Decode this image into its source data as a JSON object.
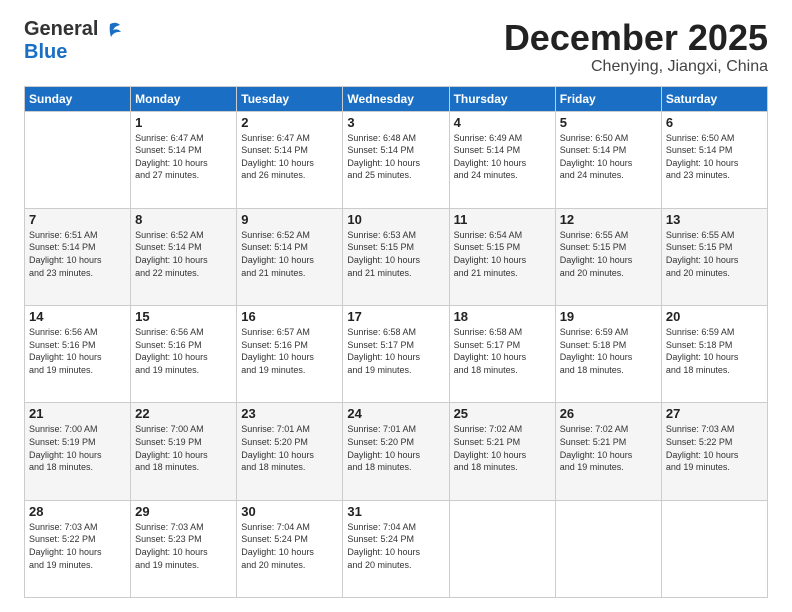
{
  "logo": {
    "line1": "General",
    "line2": "Blue"
  },
  "header": {
    "month": "December 2025",
    "location": "Chenying, Jiangxi, China"
  },
  "weekdays": [
    "Sunday",
    "Monday",
    "Tuesday",
    "Wednesday",
    "Thursday",
    "Friday",
    "Saturday"
  ],
  "weeks": [
    [
      {
        "day": "",
        "info": ""
      },
      {
        "day": "1",
        "info": "Sunrise: 6:47 AM\nSunset: 5:14 PM\nDaylight: 10 hours\nand 27 minutes."
      },
      {
        "day": "2",
        "info": "Sunrise: 6:47 AM\nSunset: 5:14 PM\nDaylight: 10 hours\nand 26 minutes."
      },
      {
        "day": "3",
        "info": "Sunrise: 6:48 AM\nSunset: 5:14 PM\nDaylight: 10 hours\nand 25 minutes."
      },
      {
        "day": "4",
        "info": "Sunrise: 6:49 AM\nSunset: 5:14 PM\nDaylight: 10 hours\nand 24 minutes."
      },
      {
        "day": "5",
        "info": "Sunrise: 6:50 AM\nSunset: 5:14 PM\nDaylight: 10 hours\nand 24 minutes."
      },
      {
        "day": "6",
        "info": "Sunrise: 6:50 AM\nSunset: 5:14 PM\nDaylight: 10 hours\nand 23 minutes."
      }
    ],
    [
      {
        "day": "7",
        "info": "Sunrise: 6:51 AM\nSunset: 5:14 PM\nDaylight: 10 hours\nand 23 minutes."
      },
      {
        "day": "8",
        "info": "Sunrise: 6:52 AM\nSunset: 5:14 PM\nDaylight: 10 hours\nand 22 minutes."
      },
      {
        "day": "9",
        "info": "Sunrise: 6:52 AM\nSunset: 5:14 PM\nDaylight: 10 hours\nand 21 minutes."
      },
      {
        "day": "10",
        "info": "Sunrise: 6:53 AM\nSunset: 5:15 PM\nDaylight: 10 hours\nand 21 minutes."
      },
      {
        "day": "11",
        "info": "Sunrise: 6:54 AM\nSunset: 5:15 PM\nDaylight: 10 hours\nand 21 minutes."
      },
      {
        "day": "12",
        "info": "Sunrise: 6:55 AM\nSunset: 5:15 PM\nDaylight: 10 hours\nand 20 minutes."
      },
      {
        "day": "13",
        "info": "Sunrise: 6:55 AM\nSunset: 5:15 PM\nDaylight: 10 hours\nand 20 minutes."
      }
    ],
    [
      {
        "day": "14",
        "info": "Sunrise: 6:56 AM\nSunset: 5:16 PM\nDaylight: 10 hours\nand 19 minutes."
      },
      {
        "day": "15",
        "info": "Sunrise: 6:56 AM\nSunset: 5:16 PM\nDaylight: 10 hours\nand 19 minutes."
      },
      {
        "day": "16",
        "info": "Sunrise: 6:57 AM\nSunset: 5:16 PM\nDaylight: 10 hours\nand 19 minutes."
      },
      {
        "day": "17",
        "info": "Sunrise: 6:58 AM\nSunset: 5:17 PM\nDaylight: 10 hours\nand 19 minutes."
      },
      {
        "day": "18",
        "info": "Sunrise: 6:58 AM\nSunset: 5:17 PM\nDaylight: 10 hours\nand 18 minutes."
      },
      {
        "day": "19",
        "info": "Sunrise: 6:59 AM\nSunset: 5:18 PM\nDaylight: 10 hours\nand 18 minutes."
      },
      {
        "day": "20",
        "info": "Sunrise: 6:59 AM\nSunset: 5:18 PM\nDaylight: 10 hours\nand 18 minutes."
      }
    ],
    [
      {
        "day": "21",
        "info": "Sunrise: 7:00 AM\nSunset: 5:19 PM\nDaylight: 10 hours\nand 18 minutes."
      },
      {
        "day": "22",
        "info": "Sunrise: 7:00 AM\nSunset: 5:19 PM\nDaylight: 10 hours\nand 18 minutes."
      },
      {
        "day": "23",
        "info": "Sunrise: 7:01 AM\nSunset: 5:20 PM\nDaylight: 10 hours\nand 18 minutes."
      },
      {
        "day": "24",
        "info": "Sunrise: 7:01 AM\nSunset: 5:20 PM\nDaylight: 10 hours\nand 18 minutes."
      },
      {
        "day": "25",
        "info": "Sunrise: 7:02 AM\nSunset: 5:21 PM\nDaylight: 10 hours\nand 18 minutes."
      },
      {
        "day": "26",
        "info": "Sunrise: 7:02 AM\nSunset: 5:21 PM\nDaylight: 10 hours\nand 19 minutes."
      },
      {
        "day": "27",
        "info": "Sunrise: 7:03 AM\nSunset: 5:22 PM\nDaylight: 10 hours\nand 19 minutes."
      }
    ],
    [
      {
        "day": "28",
        "info": "Sunrise: 7:03 AM\nSunset: 5:22 PM\nDaylight: 10 hours\nand 19 minutes."
      },
      {
        "day": "29",
        "info": "Sunrise: 7:03 AM\nSunset: 5:23 PM\nDaylight: 10 hours\nand 19 minutes."
      },
      {
        "day": "30",
        "info": "Sunrise: 7:04 AM\nSunset: 5:24 PM\nDaylight: 10 hours\nand 20 minutes."
      },
      {
        "day": "31",
        "info": "Sunrise: 7:04 AM\nSunset: 5:24 PM\nDaylight: 10 hours\nand 20 minutes."
      },
      {
        "day": "",
        "info": ""
      },
      {
        "day": "",
        "info": ""
      },
      {
        "day": "",
        "info": ""
      }
    ]
  ]
}
